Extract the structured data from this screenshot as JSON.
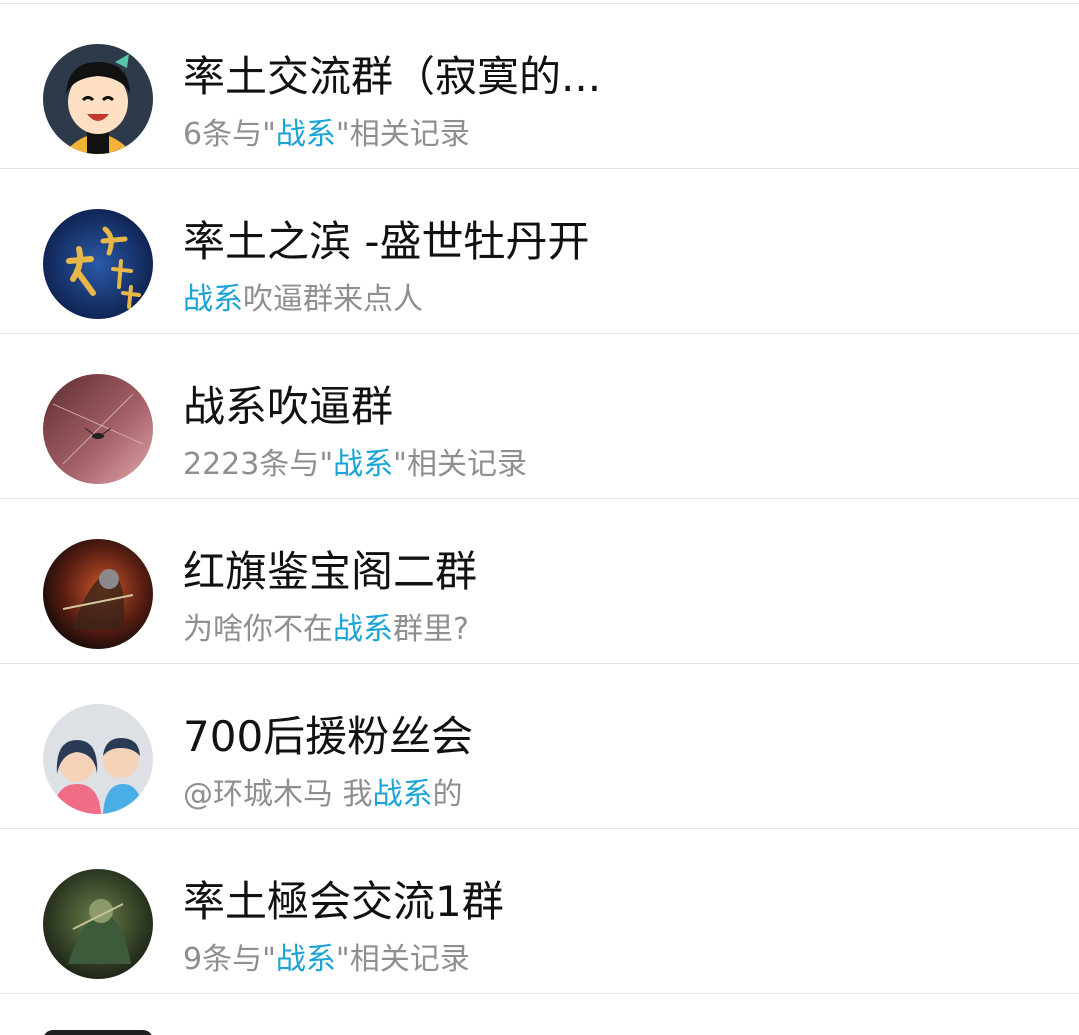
{
  "results": [
    {
      "title": "率土交流群（寂寞的...",
      "subtitle": {
        "before": "6条与\"",
        "keyword": "战系",
        "after": "\"相关记录"
      },
      "avatar_icon": "cartoon-boy-avatar"
    },
    {
      "title": "率土之滨 -盛世牡丹开",
      "subtitle": {
        "before": "",
        "keyword": "战系",
        "after": "吹逼群来点人"
      },
      "avatar_icon": "calligraphy-avatar"
    },
    {
      "title": "战系吹逼群",
      "subtitle": {
        "before": "2223条与\"",
        "keyword": "战系",
        "after": "\"相关记录"
      },
      "avatar_icon": "insect-photo-avatar"
    },
    {
      "title": "红旗鉴宝阁二群",
      "subtitle": {
        "before": "为啥你不在",
        "keyword": "战系",
        "after": "群里?"
      },
      "avatar_icon": "warrior-art-avatar"
    },
    {
      "title": "700后援粉丝会",
      "subtitle": {
        "before": "@环城木马 我",
        "keyword": "战系",
        "after": "的"
      },
      "avatar_icon": "default-group-avatar"
    },
    {
      "title": "率土極会交流1群",
      "subtitle": {
        "before": "9条与\"",
        "keyword": "战系",
        "after": "\"相关记录"
      },
      "avatar_icon": "green-warrior-avatar"
    }
  ],
  "colors": {
    "highlight": "#1aa3d6",
    "title": "#111111",
    "subtitle": "#8f8f8f",
    "divider": "#e3e3e3"
  }
}
